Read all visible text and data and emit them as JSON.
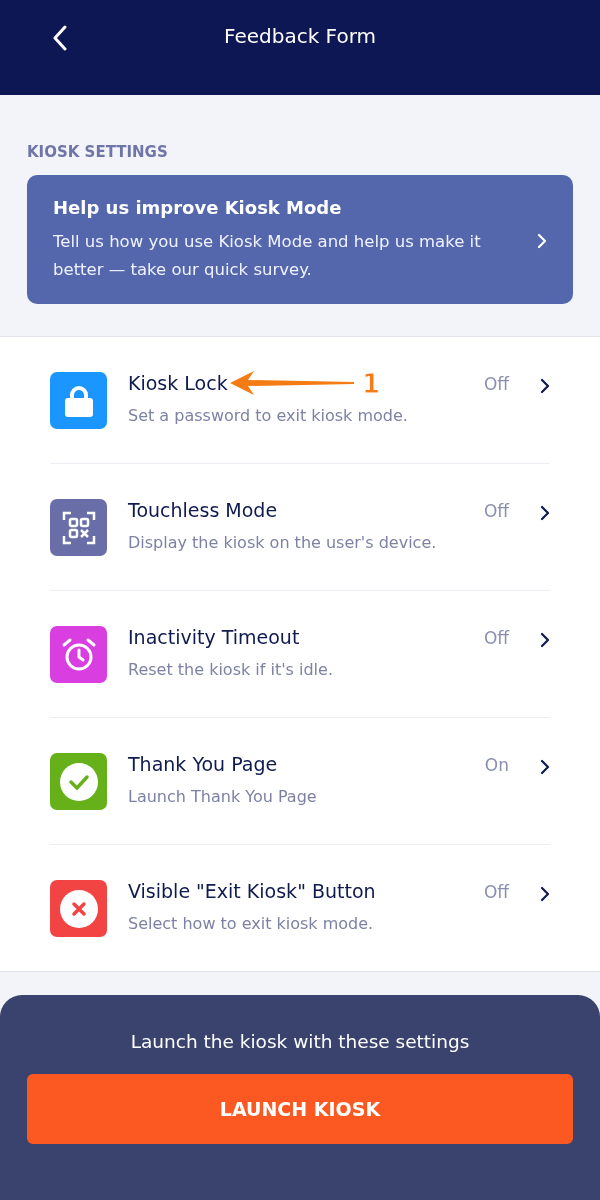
{
  "header": {
    "title": "Feedback Form"
  },
  "section_label": "KIOSK SETTINGS",
  "banner": {
    "title": "Help us improve Kiosk Mode",
    "text": "Tell us how you use Kiosk Mode and help us make it better — take our quick survey."
  },
  "settings": [
    {
      "kind": "lock",
      "color": "#1c96ff",
      "title": "Kiosk Lock",
      "description": "Set a password to exit kiosk mode.",
      "status": "Off",
      "annotation": "1"
    },
    {
      "kind": "qr",
      "color": "#6a6ea8",
      "title": "Touchless Mode",
      "description": "Display the kiosk on the user's device.",
      "status": "Off"
    },
    {
      "kind": "alarm",
      "color": "#d93ee0",
      "title": "Inactivity Timeout",
      "description": "Reset the kiosk if it's idle.",
      "status": "Off"
    },
    {
      "kind": "check",
      "color": "#66b11a",
      "title": "Thank You Page",
      "description": "Launch Thank You Page",
      "status": "On"
    },
    {
      "kind": "close",
      "color": "#f34444",
      "title": "Visible \"Exit Kiosk\" Button",
      "description": "Select how to exit kiosk mode.",
      "status": "Off"
    }
  ],
  "footer": {
    "text": "Launch the kiosk with these settings",
    "button": "LAUNCH KIOSK"
  }
}
